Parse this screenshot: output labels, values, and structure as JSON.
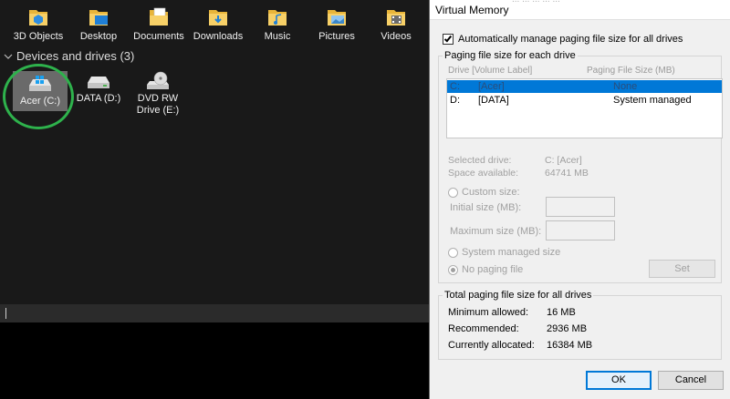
{
  "explorer": {
    "folders": [
      {
        "label": "3D Objects",
        "icon": "3d-objects-icon"
      },
      {
        "label": "Desktop",
        "icon": "desktop-icon"
      },
      {
        "label": "Documents",
        "icon": "documents-icon"
      },
      {
        "label": "Downloads",
        "icon": "downloads-icon"
      },
      {
        "label": "Music",
        "icon": "music-icon"
      },
      {
        "label": "Pictures",
        "icon": "pictures-icon"
      },
      {
        "label": "Videos",
        "icon": "videos-icon"
      }
    ],
    "devices_header": "Devices and drives (3)",
    "drives": [
      {
        "label": "Acer (C:)",
        "icon": "windows-drive-icon"
      },
      {
        "label": "DATA (D:)",
        "icon": "hard-drive-icon"
      },
      {
        "label": "DVD RW",
        "label2": "Drive (E:)",
        "icon": "dvd-drive-icon"
      }
    ],
    "colors": {
      "background": "#191919",
      "selected": "#6a6a6a",
      "highlight_circle": "#2eb24c"
    }
  },
  "dialog": {
    "title": "Virtual Memory",
    "title_ghost": "... ... ... ... ...",
    "auto_manage_label": "Automatically manage paging file size for all drives",
    "auto_manage_checked": true,
    "paging_group_label": "Paging file size for each drive",
    "columns": {
      "drive": "Drive  [Volume Label]",
      "size": "Paging File Size (MB)"
    },
    "drive_rows": [
      {
        "drive": "C:",
        "label": "[Acer]",
        "size": "None"
      },
      {
        "drive": "D:",
        "label": "[DATA]",
        "size": "System managed"
      }
    ],
    "selected_drive_label": "Selected drive:",
    "selected_drive_value": "C:  [Acer]",
    "space_available_label": "Space available:",
    "space_available_value": "64741 MB",
    "custom_size_label": "Custom size:",
    "initial_size_label": "Initial size (MB):",
    "maximum_size_label": "Maximum size (MB):",
    "system_managed_label": "System managed size",
    "no_paging_label": "No paging file",
    "set_label": "Set",
    "total_group_label": "Total paging file size for all drives",
    "minimum_label": "Minimum allowed:",
    "minimum_value": "16 MB",
    "recommended_label": "Recommended:",
    "recommended_value": "2936 MB",
    "allocated_label": "Currently allocated:",
    "allocated_value": "16384 MB",
    "ok_label": "OK",
    "cancel_label": "Cancel",
    "colors": {
      "accent": "#0078d7",
      "face": "#f0f0f0",
      "disabled_text": "#a0a0a0"
    }
  }
}
